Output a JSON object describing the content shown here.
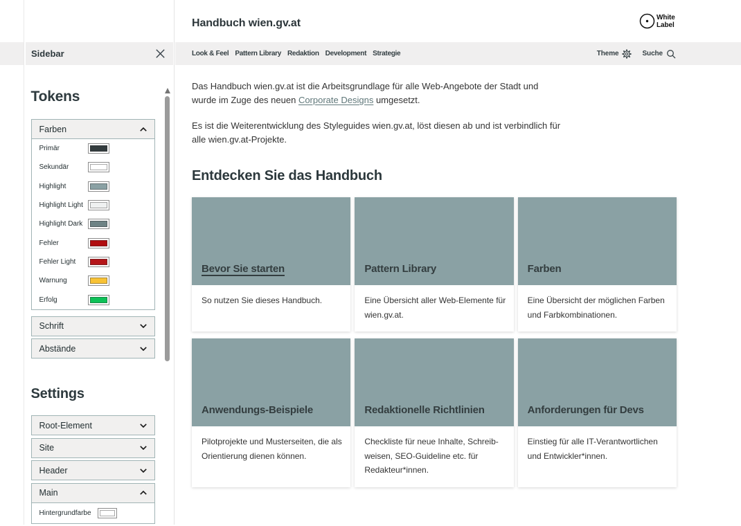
{
  "app": {
    "title": "Handbuch wien.gv.at",
    "logo": {
      "line1": "White",
      "line2": "Label"
    },
    "nav": {
      "items": [
        {
          "label": "Look & Feel"
        },
        {
          "label": "Pattern Library"
        },
        {
          "label": "Redaktion"
        },
        {
          "label": "Development"
        },
        {
          "label": "Strategie"
        }
      ],
      "theme_label": "Theme",
      "search_label": "Suche"
    },
    "intro": {
      "p1_before": "Das Handbuch wien.gv.at ist die Arbeitsgrundlage für alle Web-Angebote der Stadt und wurde im Zuge des neuen ",
      "p1_link": "Corporate Designs",
      "p1_after": " umgesetzt.",
      "p2": "Es ist die Weiterentwicklung des Styleguides wien.gv.at, löst diesen ab und ist verbindlich für alle wien.gv.at-Projekte."
    },
    "section_title": "Entdecken Sie das Handbuch",
    "cards": [
      {
        "title": "Bevor Sie starten",
        "description": "So nutzen Sie dieses Handbuch."
      },
      {
        "title": "Pattern Library",
        "description": "Eine Übersicht aller Web-Elemente für wien.gv.at."
      },
      {
        "title": "Farben",
        "description": "Eine Übersicht der möglichen Farben und Farbkombinationen."
      },
      {
        "title": "Anwendungs-Beispiele",
        "description": "Pilotprojekte und Musterseiten, die als Orientierung dienen können."
      },
      {
        "title": "Redaktionelle Richtlinien",
        "description": "Checkliste für neue Inhalte, Schreib­weisen, SEO-Guideline etc. für Redakteur*innen."
      },
      {
        "title": "Anforderungen für Devs",
        "description": "Einstieg für alle IT-Verantwortlichen und Entwickler*innen."
      }
    ],
    "card_accent_color": "#8aa1a4"
  },
  "sidebar": {
    "title": "Sidebar",
    "tokens_heading": "Tokens",
    "settings_heading": "Settings",
    "tokens": {
      "farben_label": "Farben",
      "farben_rows": [
        {
          "label": "Primär",
          "color": "#333c3e"
        },
        {
          "label": "Sekundär",
          "color": "#ffffff"
        },
        {
          "label": "Highlight",
          "color": "#8aa1a4"
        },
        {
          "label": "Highlight Light",
          "color": "#eff1f1"
        },
        {
          "label": "Highlight Dark",
          "color": "#6e8385"
        },
        {
          "label": "Fehler",
          "color": "#b00d10"
        },
        {
          "label": "Fehler Light",
          "color": "#b5161a"
        },
        {
          "label": "Warnung",
          "color": "#f8c235"
        },
        {
          "label": "Erfolg",
          "color": "#0dc157"
        }
      ],
      "schrift_label": "Schrift",
      "abstaende_label": "Abstände"
    },
    "settings": {
      "root_label": "Root-Element",
      "site_label": "Site",
      "header_label": "Header",
      "main_label": "Main",
      "main_rows": [
        {
          "label": "Hintergrundfarbe",
          "color": "#ffffff"
        }
      ]
    }
  }
}
